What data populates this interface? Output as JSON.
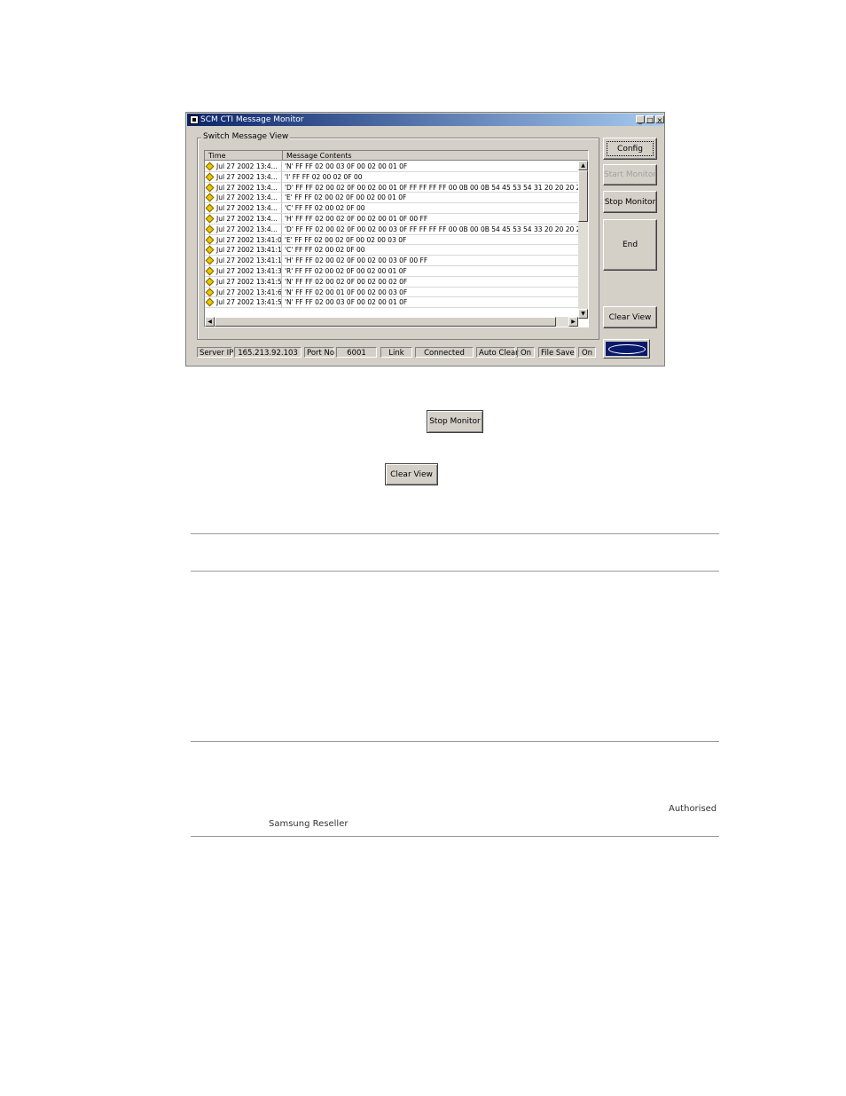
{
  "window": {
    "title": "SCM CTI Message Monitor",
    "group_label": "Switch Message View",
    "columns": [
      "Time",
      "Message Contents"
    ],
    "rows": [
      {
        "time": "Jul 27 2002 13:4...",
        "msg": "'N' FF FF 02 00 03 0F 00 02 00 01 0F"
      },
      {
        "time": "Jul 27 2002 13:4...",
        "msg": "'I' FF FF 02 00 02 0F 00"
      },
      {
        "time": "Jul 27 2002 13:4...",
        "msg": "'D' FF FF 02 00 02 0F 00 02 00 01 0F FF FF FF FF 00 0B 00 0B 54 45 53 54 31 20 20 20 2"
      },
      {
        "time": "Jul 27 2002 13:4...",
        "msg": "'E' FF FF 02 00 02 0F 00 02 00 01 0F"
      },
      {
        "time": "Jul 27 2002 13:4...",
        "msg": "'C' FF FF 02 00 02 0F 00"
      },
      {
        "time": "Jul 27 2002 13:4...",
        "msg": "'H' FF FF 02 00 02 0F 00 02 00 01 0F 00 FF"
      },
      {
        "time": "Jul 27 2002 13:4...",
        "msg": "'D' FF FF 02 00 02 0F 00 02 00 03 0F FF FF FF FF 00 0B 00 0B 54 45 53 54 33 20 20 20 2"
      },
      {
        "time": "Jul 27 2002 13:41:0",
        "msg": "'E' FF FF 02 00 02 0F 00 02 00 03 0F"
      },
      {
        "time": "Jul 27 2002 13:41:1",
        "msg": "'C' FF FF 02 00 02 0F 00"
      },
      {
        "time": "Jul 27 2002 13:41:1",
        "msg": "'H' FF FF 02 00 02 0F 00 02 00 03 0F 00 FF"
      },
      {
        "time": "Jul 27 2002 13:41:3",
        "msg": "'R' FF FF 02 00 02 0F 00 02 00 01 0F"
      },
      {
        "time": "Jul 27 2002 13:41:5",
        "msg": "'N' FF FF 02 00 02 0F 00 02 00 02 0F"
      },
      {
        "time": "Jul 27 2002 13:41:6",
        "msg": "'N' FF FF 02 00 01 0F 00 02 00 03 0F"
      },
      {
        "time": "Jul 27 2002 13:41:5",
        "msg": "'N' FF FF 02 00 03 0F 00 02 00 01 0F"
      }
    ],
    "buttons": {
      "config": "Config",
      "start_monitor": "Start Monitor",
      "stop_monitor": "Stop Monitor",
      "end": "End",
      "clear_view": "Clear View"
    },
    "status": {
      "server_ip_label": "Server IP",
      "server_ip": "165.213.92.103",
      "port_label": "Port No",
      "port": "6001",
      "link_label": "Link",
      "link": "Connected",
      "auto_clear_label": "Auto Clear",
      "auto_clear": "On",
      "file_save_label": "File Save",
      "file_save": "On"
    }
  },
  "standalone": {
    "stop_monitor": "Stop Monitor",
    "clear_view": "Clear View"
  },
  "footer": {
    "line1": "Authorised",
    "line2": "Samsung Reseller"
  }
}
